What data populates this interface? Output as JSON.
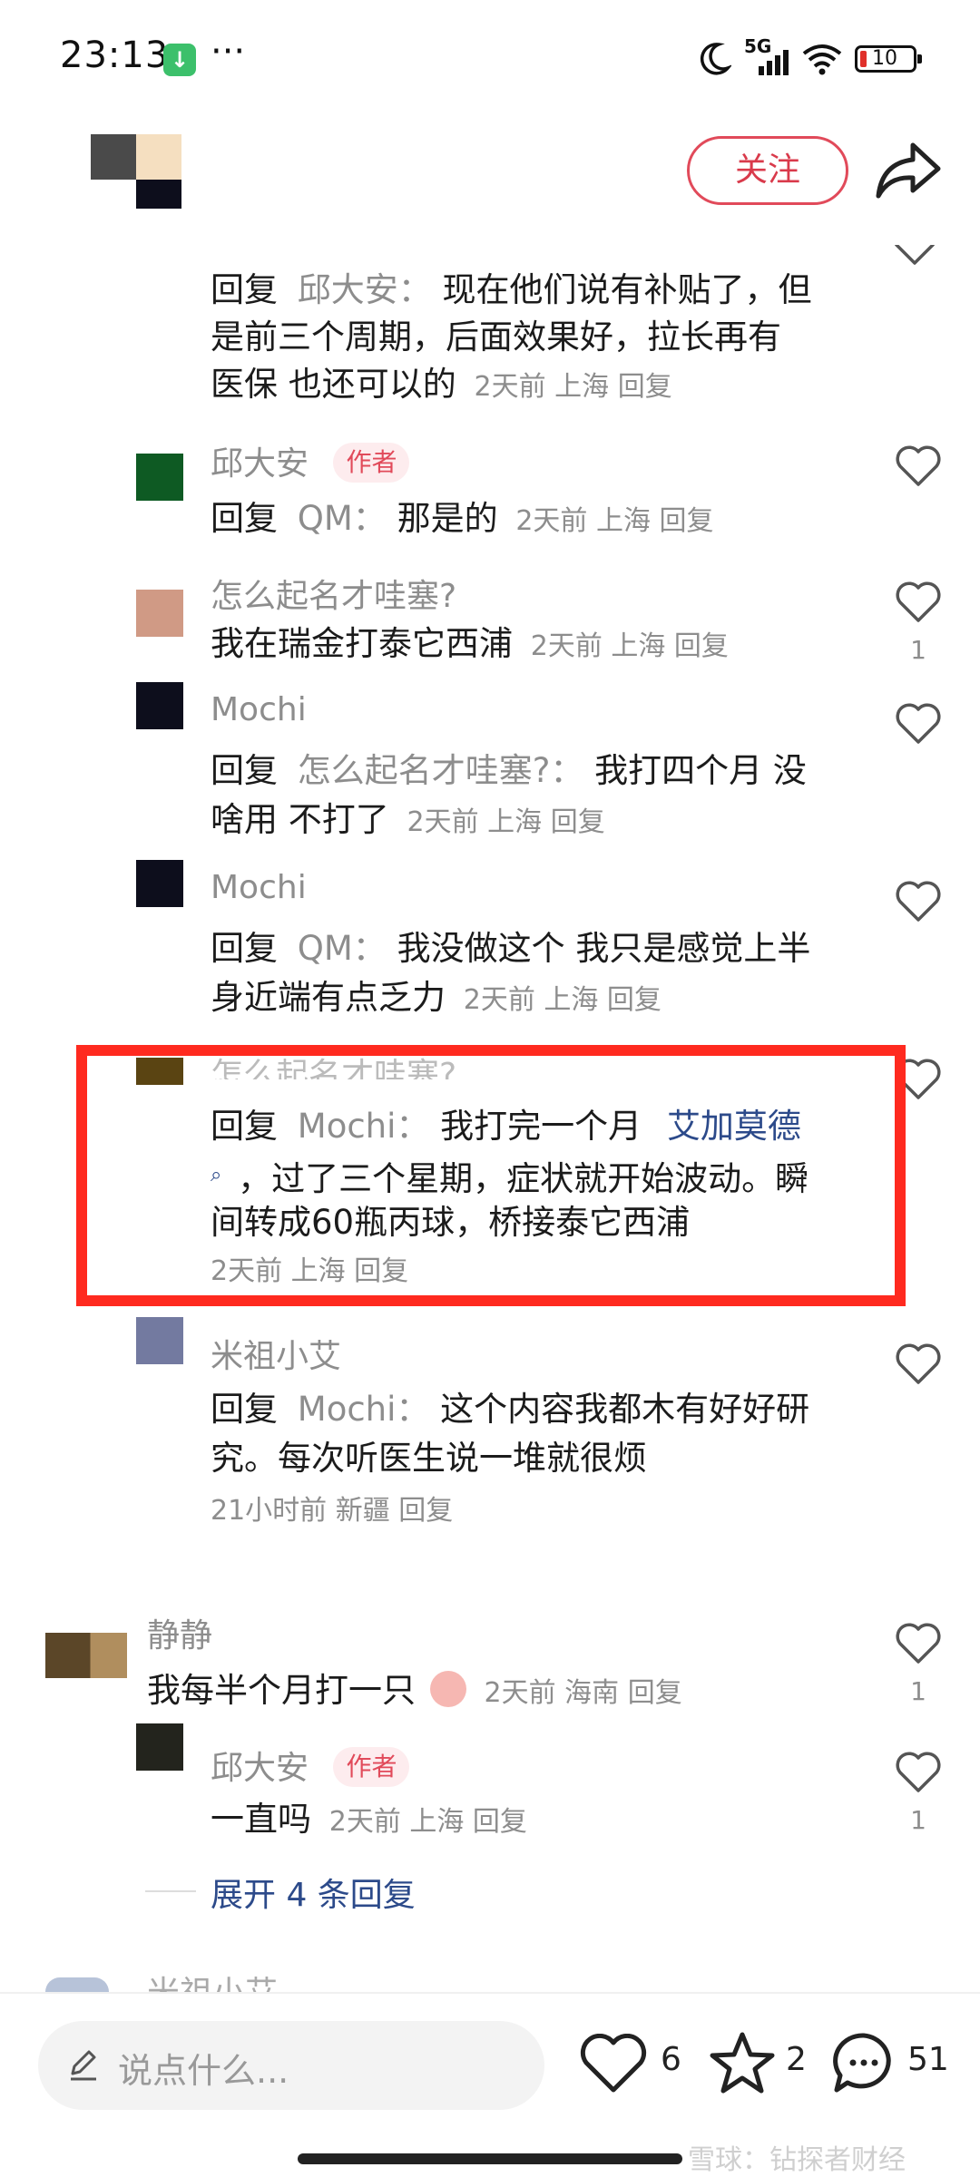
{
  "status_bar": {
    "time": "23:13",
    "network": "5G",
    "battery": "10"
  },
  "header": {
    "follow_label": "关注"
  },
  "comments": {
    "c1": {
      "prefix": "回复",
      "reply_to": "邱大安：",
      "line1": "现在他们说有补贴了，但",
      "line2": "是前三个周期，后面效果好，拉长再有",
      "line3": "医保 也还可以的",
      "meta": "2天前 上海 回复"
    },
    "c2": {
      "name": "邱大安",
      "badge": "作者",
      "prefix": "回复",
      "reply_to": "QM：",
      "text": "那是的",
      "meta": "2天前 上海 回复"
    },
    "c3": {
      "name": "怎么起名才哇塞?",
      "text": "我在瑞金打泰它西浦",
      "meta": "2天前 上海 回复",
      "likes": "1"
    },
    "c4": {
      "name": "Mochi",
      "prefix": "回复",
      "reply_to": "怎么起名才哇塞?：",
      "line1": "我打四个月 没",
      "line2": "啥用 不打了",
      "meta": "2天前 上海 回复"
    },
    "c5": {
      "name": "Mochi",
      "prefix": "回复",
      "reply_to": "QM：",
      "line1": "我没做这个 我只是感觉上半",
      "line2": "身近端有点乏力",
      "meta": "2天前 上海 回复"
    },
    "c6": {
      "name": "怎么起名才哇塞?",
      "prefix": "回复",
      "reply_to": "Mochi：",
      "line1": "我打完一个月",
      "link": "艾加莫德",
      "line2": "，过了三个星期，症状就开始波动。瞬",
      "line3": "间转成60瓶丙球，桥接泰它西浦",
      "meta": "2天前 上海 回复"
    },
    "c7": {
      "name": "米祖小艾",
      "prefix": "回复",
      "reply_to": "Mochi：",
      "line1": "这个内容我都木有好好研",
      "line2": "究。每次听医生说一堆就很烦",
      "meta": "21小时前 新疆 回复"
    },
    "c8": {
      "name": "静静",
      "text": "我每半个月打一只",
      "meta": "2天前 海南 回复",
      "likes": "1"
    },
    "c9": {
      "name": "邱大安",
      "badge": "作者",
      "text": "一直吗",
      "meta": "2天前 上海 回复",
      "likes": "1"
    },
    "expand": "展开 4 条回复",
    "c10_name": "米祖小艾"
  },
  "bottom_bar": {
    "placeholder": "说点什么...",
    "likes": "6",
    "favorites": "2",
    "comments": "51"
  },
  "watermark": "雪球：钻探者财经",
  "colors": {
    "accent": "#e14a5a",
    "highlight": "#ff2a1f",
    "link": "#2c4a8a"
  }
}
